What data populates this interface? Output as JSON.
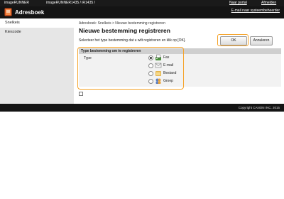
{
  "topbar": {
    "brand": "imageRUNNER",
    "model": "imageRUNNER1435 / iR1435 /",
    "links": [
      "Naar portal",
      "Afmelden"
    ]
  },
  "header": {
    "title": "Adresboek",
    "mail_link": "E-mail naar systeembeheerder"
  },
  "sidebar": {
    "items": [
      {
        "label": "Snelkeis",
        "active": true
      },
      {
        "label": "Kiescode",
        "active": false
      }
    ]
  },
  "main": {
    "breadcrumb": "Adresboek: Snelkeis > Nieuwe bestemming registreren",
    "title": "Nieuwe bestemming registreren",
    "instruction": "Selecteer het type bestemming dat u wilt registreren en klik op [OK].",
    "ok_label": "OK",
    "cancel_label": "Annuleren",
    "section_title": "Type bestemming om te registreren",
    "type_label": "Type",
    "options": [
      {
        "label": "Fax",
        "icon": "fax-icon",
        "selected": true
      },
      {
        "label": "E-mail",
        "icon": "email-icon",
        "selected": false
      },
      {
        "label": "Bestand",
        "icon": "file-icon",
        "selected": false
      },
      {
        "label": "Groep",
        "icon": "group-icon",
        "selected": false
      }
    ]
  },
  "footer": {
    "copyright": "Copyright CANON INC. 2015"
  },
  "colors": {
    "highlight": "#f5a32a",
    "header_bg": "#141414",
    "sidebar_bg": "#e6e6e6"
  }
}
